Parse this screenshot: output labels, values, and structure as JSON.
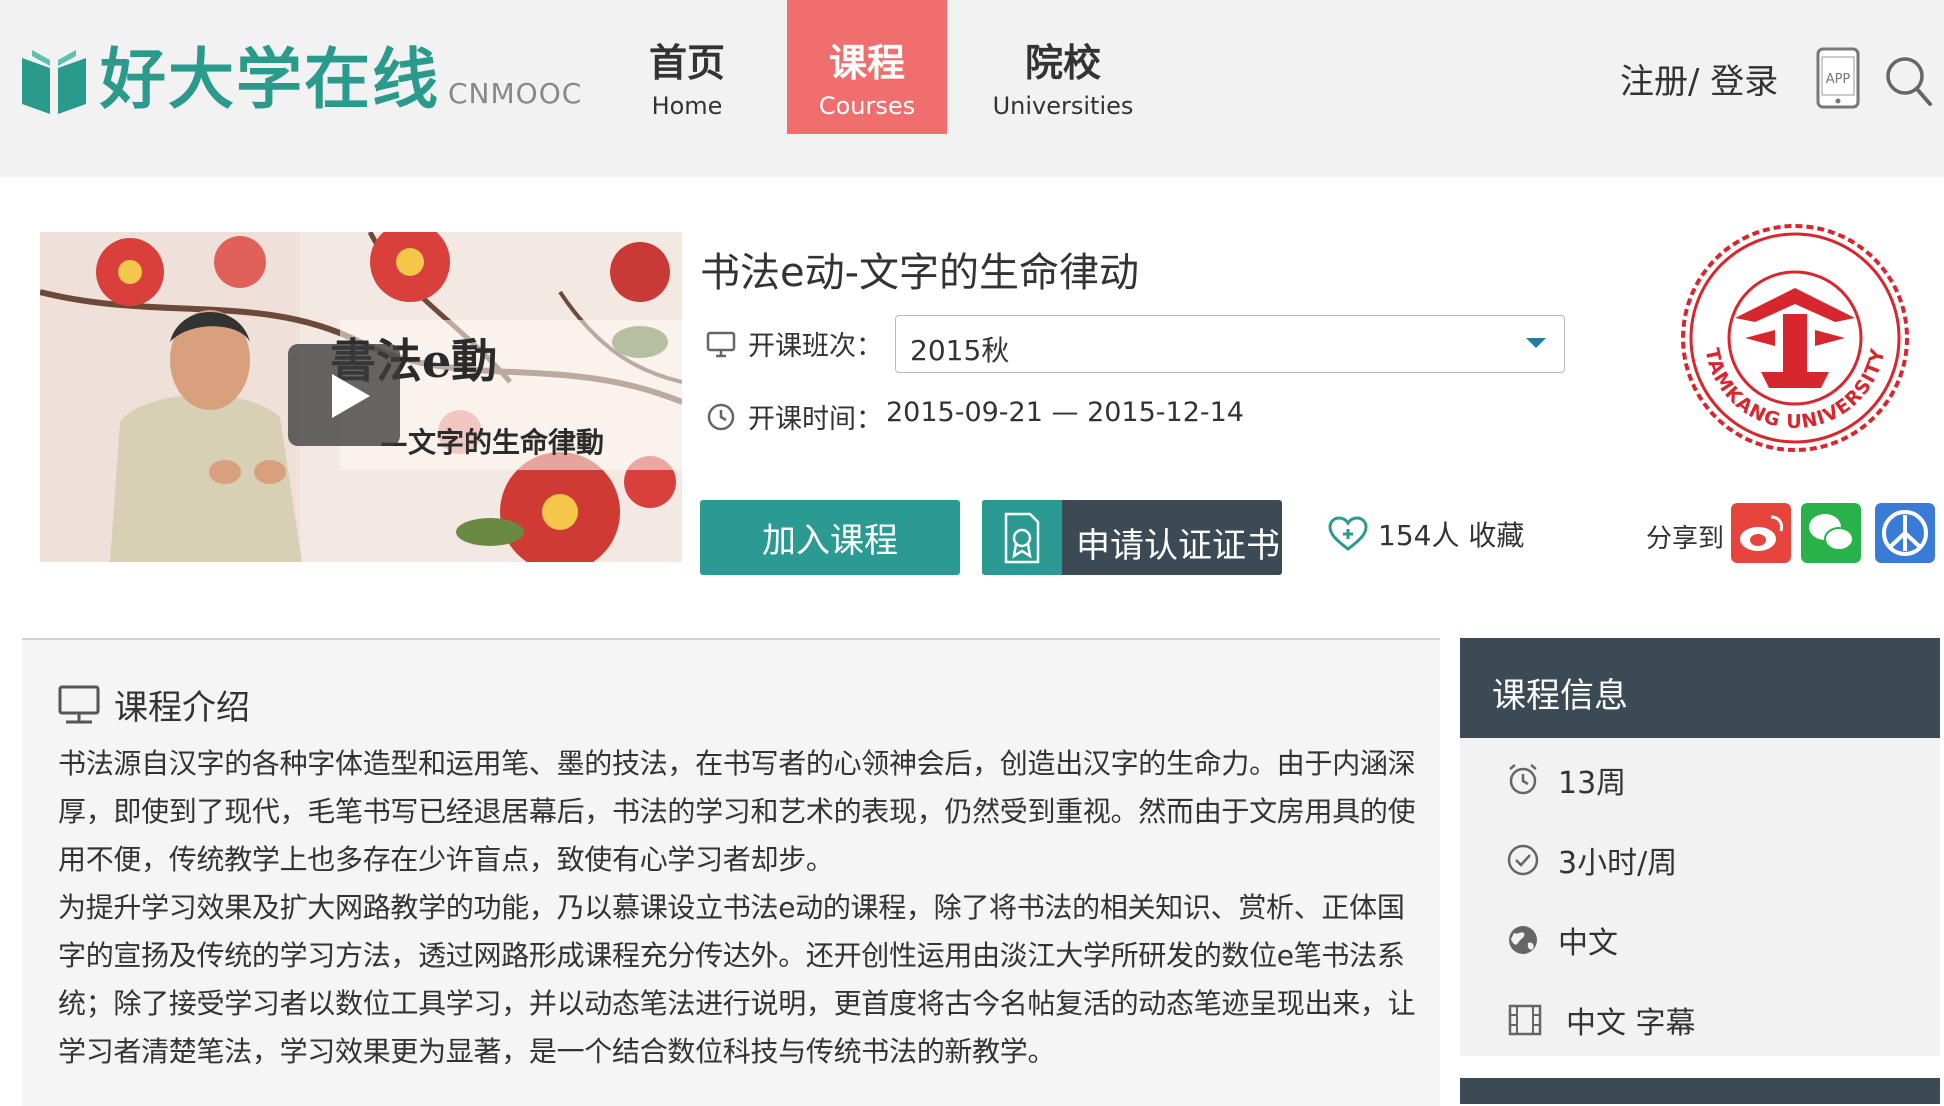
{
  "header": {
    "logo_cn": "好大学在线",
    "logo_en": "CNMOOC",
    "nav": [
      {
        "zh": "首页",
        "en": "Home"
      },
      {
        "zh": "课程",
        "en": "Courses"
      },
      {
        "zh": "院校",
        "en": "Universities"
      }
    ],
    "active_nav": "Courses",
    "login": "注册/ 登录",
    "app_label": "APP"
  },
  "course": {
    "title": "书法e动-文字的生命律动",
    "video_title": "書法e動",
    "video_subtitle": "—文字的生命律動",
    "session_label": "开课班次：",
    "session_value": "2015秋",
    "time_label": "开课时间：",
    "time_value": "2015-09-21 — 2015-12-14",
    "join_label": "加入课程",
    "cert_label": "申请认证证书",
    "favorites": "154人 收藏",
    "share_label": "分享到",
    "university_seal": "TAMKANG UNIVERSITY"
  },
  "intro": {
    "heading": "课程介绍",
    "text": "书法源自汉字的各种字体造型和运用笔、墨的技法，在书写者的心领神会后，创造出汉字的生命力。由于内涵深厚，即使到了现代，毛笔书写已经退居幕后，书法的学习和艺术的表现，仍然受到重视。然而由于文房用具的使用不便，传统教学上也多存在少许盲点，致使有心学习者却步。\n为提升学习效果及扩大网路教学的功能，乃以慕课设立书法e动的课程，除了将书法的相关知识、赏析、正体国字的宣扬及传统的学习方法，透过网路形成课程充分传达外。还开创性运用由淡江大学所研发的数位e笔书法系统；除了接受学习者以数位工具学习，并以动态笔法进行说明，更首度将古今名帖复活的动态笔迹呈现出来，让学习者清楚笔法，学习效果更为显著，是一个结合数位科技与传统书法的新教学。"
  },
  "info": {
    "heading": "课程信息",
    "items": [
      {
        "icon": "alarm-clock-icon",
        "text": "13周"
      },
      {
        "icon": "check-circle-icon",
        "text": "3小时/周"
      },
      {
        "icon": "globe-icon",
        "text": "中文"
      },
      {
        "icon": "film-icon",
        "text": "中文 字幕"
      }
    ]
  },
  "colors": {
    "teal": "#2a9a93",
    "nav_active": "#f06e6e",
    "dark_slate": "#3b4a54",
    "seal_red": "#d8262e"
  }
}
